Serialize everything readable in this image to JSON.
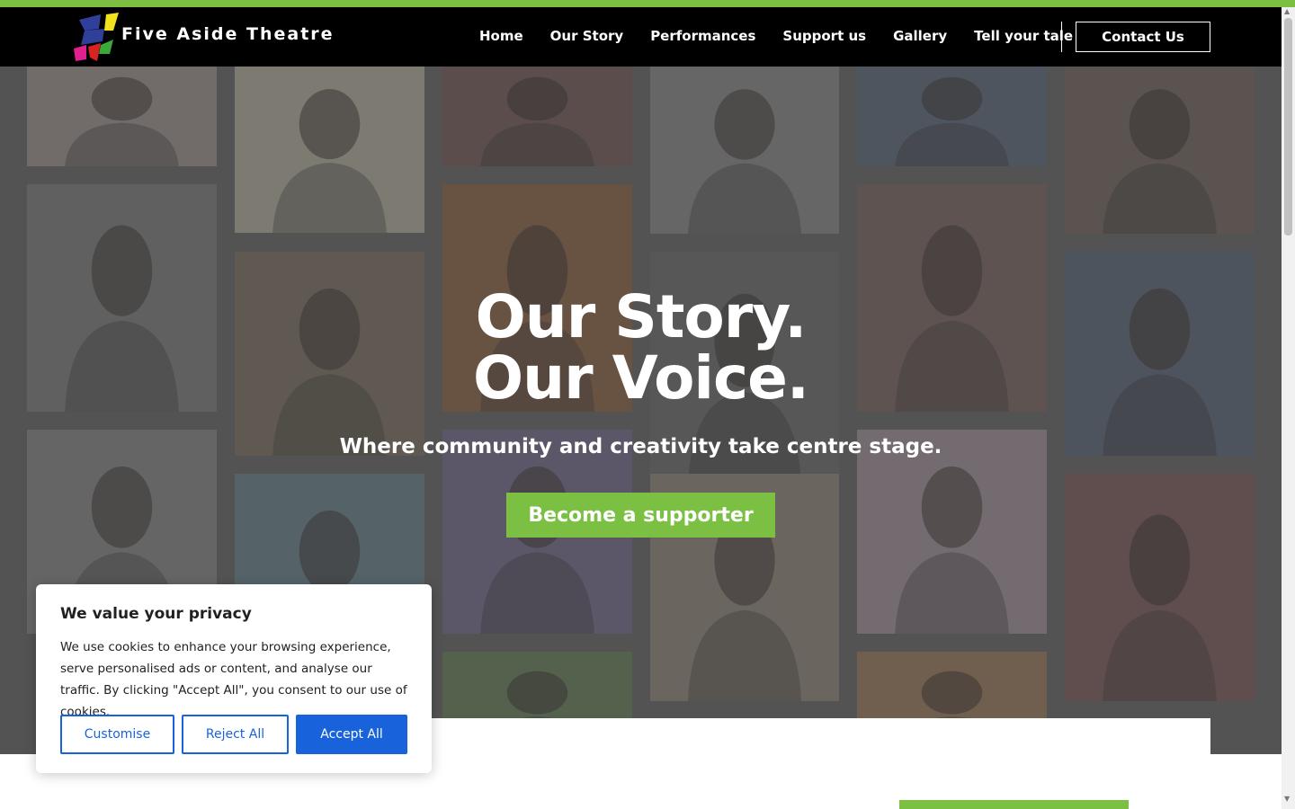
{
  "brand": {
    "name": "Five Aside Theatre"
  },
  "nav": {
    "items": [
      "Home",
      "Our Story",
      "Performances",
      "Support us",
      "Gallery",
      "Tell your tale"
    ],
    "contact_label": "Contact Us"
  },
  "hero": {
    "title_line1": "Our Story.",
    "title_line2": "Our Voice.",
    "subtitle": "Where community and creativity take centre stage.",
    "cta_label": "Become a supporter"
  },
  "cookie_banner": {
    "title": "We value your privacy",
    "text": "We use cookies to enhance your browsing experience, serve personalised ads or content, and analyse our traffic. By clicking \"Accept All\", you consent to our use of cookies.",
    "buttons": {
      "customise": "Customise",
      "reject": "Reject All",
      "accept": "Accept All"
    }
  },
  "gallery_tiles": [
    "portrait-woman-cardigan",
    "saturday-soup-poster",
    "performer-red-top",
    "dress-photo-bw",
    "performer-blue",
    "dorothee-poster",
    "elder-performer-mic",
    "elder-storyteller",
    "man-portrait-orange",
    "man-at-mic",
    "rehearsal-table",
    "man-period-costume",
    "saturday-soup-poster-bw",
    "woman-headwrap",
    "dorothee-flyer",
    "young-man-embroidered",
    "saturday-soup-woman",
    "woman-velvet-jacket",
    "group-outdoors",
    "man-portrait-bald"
  ],
  "colors": {
    "accent_green": "#7bc043",
    "header_bg": "#000000",
    "cookie_blue": "#1863dc"
  }
}
